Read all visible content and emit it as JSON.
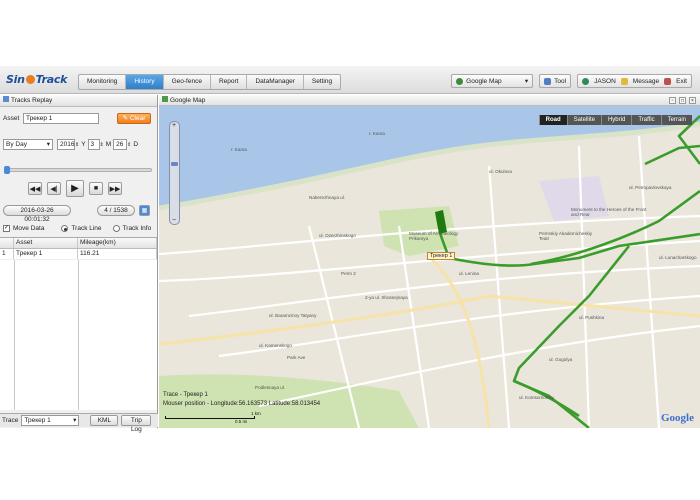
{
  "app": {
    "logo_pre": "Sin",
    "logo_post": "Track"
  },
  "nav": [
    "Monitoring",
    "History",
    "Geo-fence",
    "Report",
    "DataManager",
    "Setting"
  ],
  "topright": {
    "map_select": "Google Map",
    "tool": "Tool",
    "user": "JASON",
    "message": "Message",
    "exit": "Exit"
  },
  "left": {
    "title": "Tracks Replay",
    "asset_label": "Asset",
    "asset_value": "Трекер 1",
    "clear": "Clear",
    "mode": "By Day",
    "year": "2016",
    "y_label": "Y",
    "month": "3",
    "m_label": "M",
    "day": "26",
    "d_label": "D",
    "datetime": "2016-03-26 00:01:32",
    "counter": "4 / 1538",
    "move_data": "Move Data",
    "track_line": "Track Line",
    "track_info": "Track Info",
    "grid": {
      "headers": [
        "",
        "Asset",
        "Mileage(km)"
      ],
      "rows": [
        [
          "1",
          "Трекер 1",
          "116.21"
        ]
      ]
    },
    "trace_label": "Trace",
    "trace_value": "Трекер 1",
    "kml": "KML",
    "trip_log": "Trip Log"
  },
  "map": {
    "title": "Google Map",
    "types": [
      "Road",
      "Satellite",
      "Hybrid",
      "Traffic",
      "Terrain"
    ],
    "active_type": "Road",
    "labels": [
      "r. Kama",
      "r. Kama",
      "Naberezhnaya ul.",
      "ul. Ozerzhinskogo",
      "ul. Okulova",
      "ul. Lenina",
      "Monument to the Heroes of the Front and Rear",
      "Permskiy Akademicheskiy Teatr",
      "Perm 2",
      "ul. Baramzinoy Tatyany",
      "2-ya ul. Shossejnaya",
      "ul. Kamenskogo",
      "Park Ave",
      "Podlesnaya ul.",
      "ul. Petropavlovskaya",
      "ul. Lunacharskogo",
      "ul. Pushkina",
      "ul. Gogolya",
      "ul. Komsomolsky",
      "Museum of Archaeology Prikamya"
    ],
    "pin": "Трекер 1",
    "trace_line": "Trace - Трекер 1",
    "mouse_line": "Mouser position - Longitude:56.163573 Latitude:58.013454",
    "scale_km": "1 km",
    "scale_mi": "0.5 mi",
    "google": "Google",
    "colors": {
      "track": "#3a9c2a",
      "water": "#a9c6e8",
      "land": "#eae6dc",
      "park": "#cfe2b1"
    }
  }
}
